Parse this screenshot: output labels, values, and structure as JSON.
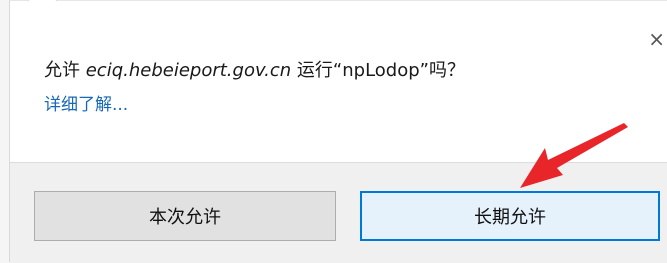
{
  "prompt": {
    "close_symbol": "×",
    "message_prefix": "允许 ",
    "site": "eciq.hebeieport.gov.cn",
    "message_suffix": " 运行“npLodop”吗？",
    "details_link": "详细了解..."
  },
  "buttons": {
    "allow_once": "本次允许",
    "allow_always": "长期允许"
  },
  "annotation": {
    "arrow_color": "#e8262a"
  }
}
